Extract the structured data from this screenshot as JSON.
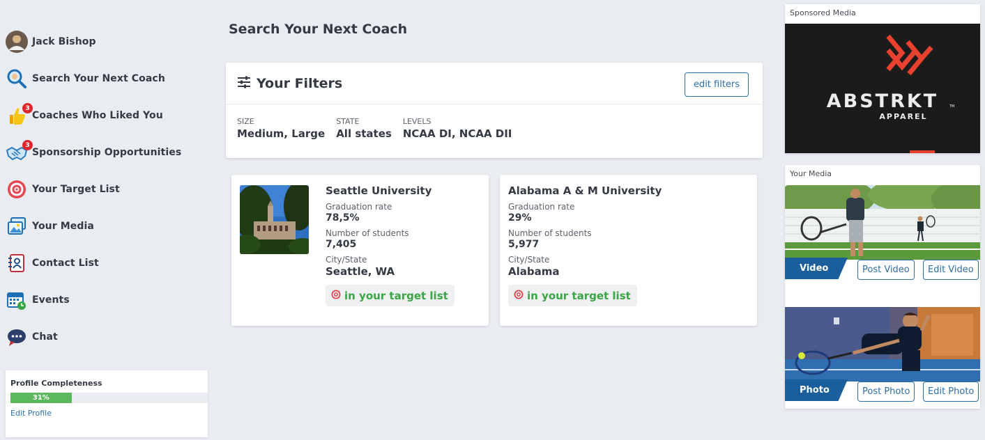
{
  "sidebar": {
    "user_name": "Jack Bishop",
    "items": [
      {
        "label": "Search Your Next Coach",
        "icon": "search-icon"
      },
      {
        "label": "Coaches Who Liked You",
        "icon": "thumbs-up-icon",
        "badge": "3"
      },
      {
        "label": "Sponsorship Opportunities",
        "icon": "handshake-icon",
        "badge": "3"
      },
      {
        "label": "Your Target List",
        "icon": "target-icon"
      },
      {
        "label": "Your Media",
        "icon": "media-icon"
      },
      {
        "label": "Contact List",
        "icon": "contact-book-icon"
      },
      {
        "label": "Events",
        "icon": "calendar-icon"
      },
      {
        "label": "Chat",
        "icon": "chat-bubble-icon"
      }
    ],
    "profile": {
      "title": "Profile Completeness",
      "percent_label": "31%",
      "percent": 31,
      "edit_label": "Edit Profile"
    }
  },
  "main": {
    "title": "Search Your Next Coach",
    "filters": {
      "title": "Your Filters",
      "edit_label": "edit filters",
      "items": [
        {
          "label": "SIZE",
          "value": "Medium, Large"
        },
        {
          "label": "STATE",
          "value": "All states"
        },
        {
          "label": "LEVELS",
          "value": "NCAA DI, NCAA DII"
        }
      ]
    },
    "schools": [
      {
        "name": "Seattle University",
        "grad_label": "Graduation rate",
        "grad_value": "78,5%",
        "students_label": "Number of students",
        "students_value": "7,405",
        "city_label": "City/State",
        "city_value": "Seattle, WA",
        "target_label": "in your target list"
      },
      {
        "name": "Alabama A & M University",
        "grad_label": "Graduation rate",
        "grad_value": "29%",
        "students_label": "Number of students",
        "students_value": "5,977",
        "city_label": "City/State",
        "city_value": "Alabama",
        "target_label": "in your target list"
      }
    ]
  },
  "right": {
    "sponsored_label": "Sponsored Media",
    "sponsor_brand": "ABSTRKT",
    "sponsor_tm": "TM",
    "sponsor_sub": "APPAREL",
    "media_label": "Your Media",
    "video": {
      "tag": "Video",
      "post_label": "Post Video",
      "edit_label": "Edit Video"
    },
    "photo": {
      "tag": "Photo",
      "post_label": "Post Photo",
      "edit_label": "Edit Photo"
    }
  },
  "colors": {
    "accent_blue": "#2c6ea8",
    "tag_blue": "#1a5f9b",
    "success_green": "#3aa545",
    "badge_red": "#e0262d",
    "background": "#e9ecf1"
  }
}
